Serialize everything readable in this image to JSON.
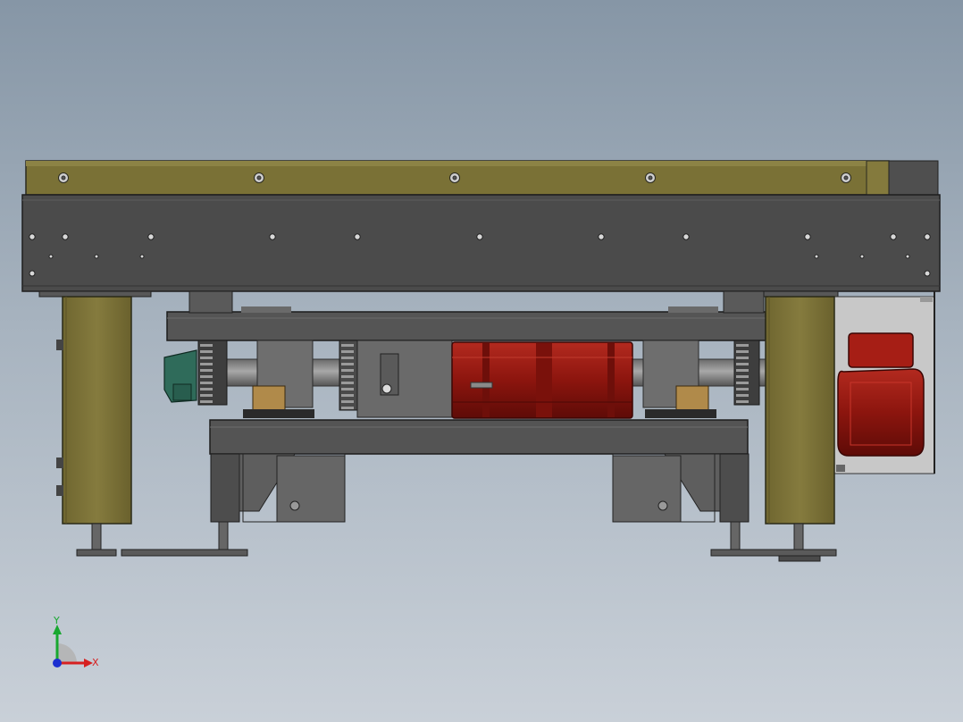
{
  "viewport": {
    "type": "cad-model-view",
    "background_top": "#8696a6",
    "background_bottom": "#c9d0d8"
  },
  "colors": {
    "frame_olive": "#7d7338",
    "frame_olive_dark": "#5e5628",
    "steel_dark": "#4a4a4a",
    "steel_mid": "#5c5c5c",
    "steel_light": "#8a8a8a",
    "motor_red": "#9a1a12",
    "motor_red_dark": "#6e0f0a",
    "bearing_green": "#2f6b5a",
    "brass": "#b08a4a",
    "plate_grey": "#c9c9c9"
  },
  "components": [
    "conveyor-top-rail",
    "main-side-beam",
    "left-support-leg",
    "right-support-leg",
    "upper-cross-frame",
    "drive-shaft",
    "gear-motor",
    "side-drive-motor",
    "lower-base-frame",
    "leveling-feet"
  ],
  "triad": {
    "x_label": "X",
    "y_label": "Y",
    "x_color": "#d62020",
    "y_color": "#18a830",
    "z_color": "#1c2fd0"
  }
}
